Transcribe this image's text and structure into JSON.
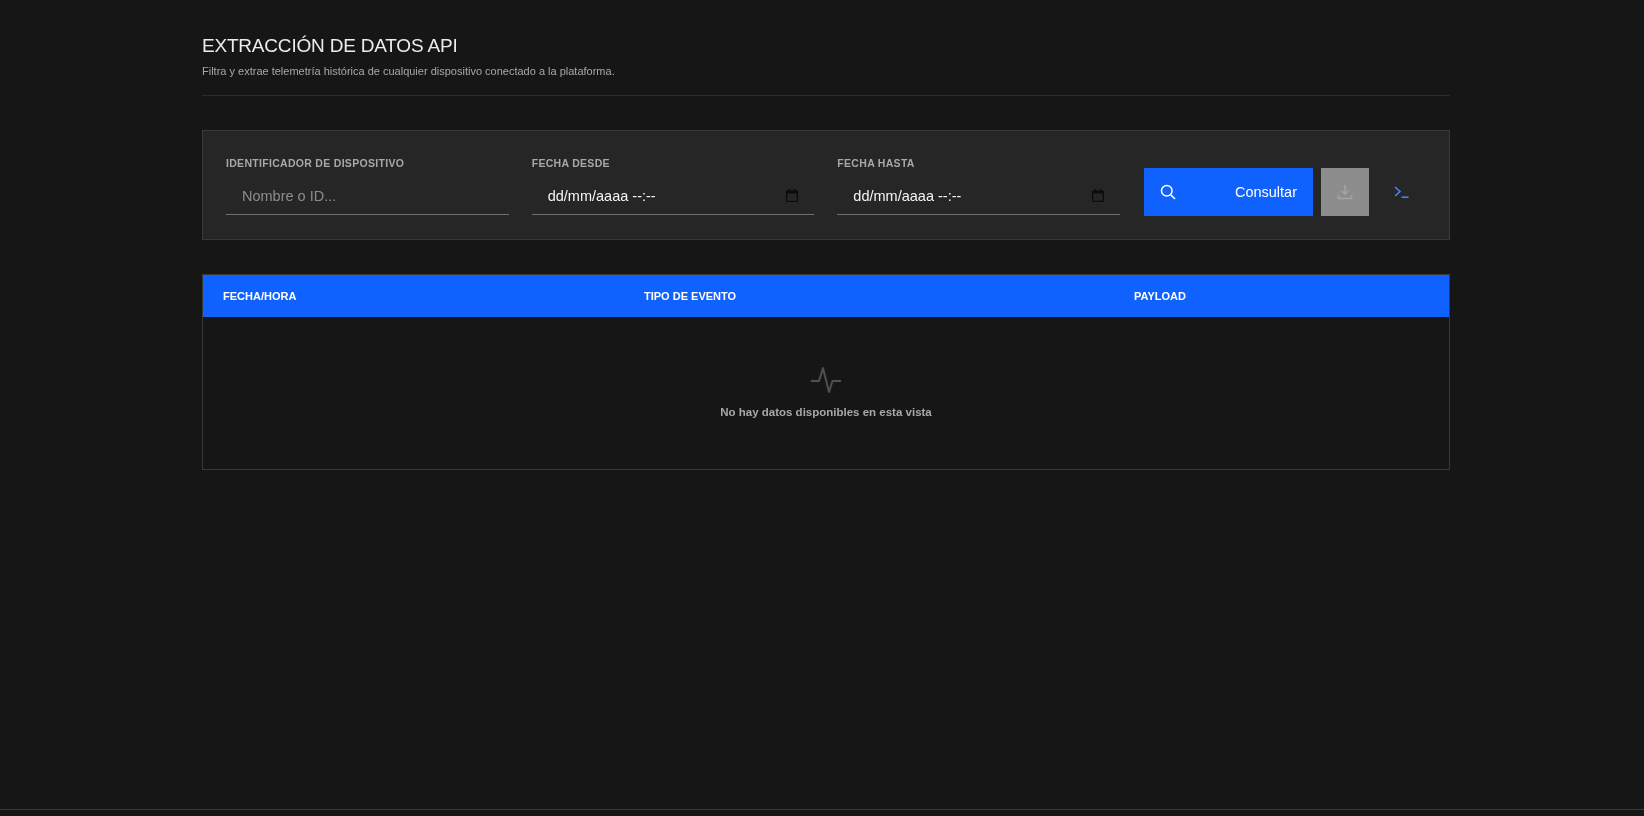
{
  "header": {
    "title": "EXTRACCIÓN DE DATOS API",
    "subtitle": "Filtra y extrae telemetría histórica de cualquier dispositivo conectado a la plataforma."
  },
  "filters": [
    {
      "kind": "text",
      "label": "IDENTIFICADOR DE DISPOSITIVO",
      "placeholder": "Nombre o ID..."
    },
    {
      "kind": "datetime",
      "label": "FECHA DESDE",
      "placeholder": "dd/mm/aaaa --:--"
    },
    {
      "kind": "datetime",
      "label": "FECHA HASTA",
      "placeholder": "dd/mm/aaaa --:--"
    }
  ],
  "actions": [
    {
      "kind": "query",
      "label": "Consultar",
      "disabled": false
    },
    {
      "kind": "download",
      "disabled": true
    },
    {
      "kind": "terminal",
      "disabled": false
    }
  ],
  "table": {
    "columns": [
      "FECHA/HORA",
      "TIPO DE EVENTO",
      "PAYLOAD"
    ],
    "empty_message": "No hay datos disponibles en esta vista"
  }
}
